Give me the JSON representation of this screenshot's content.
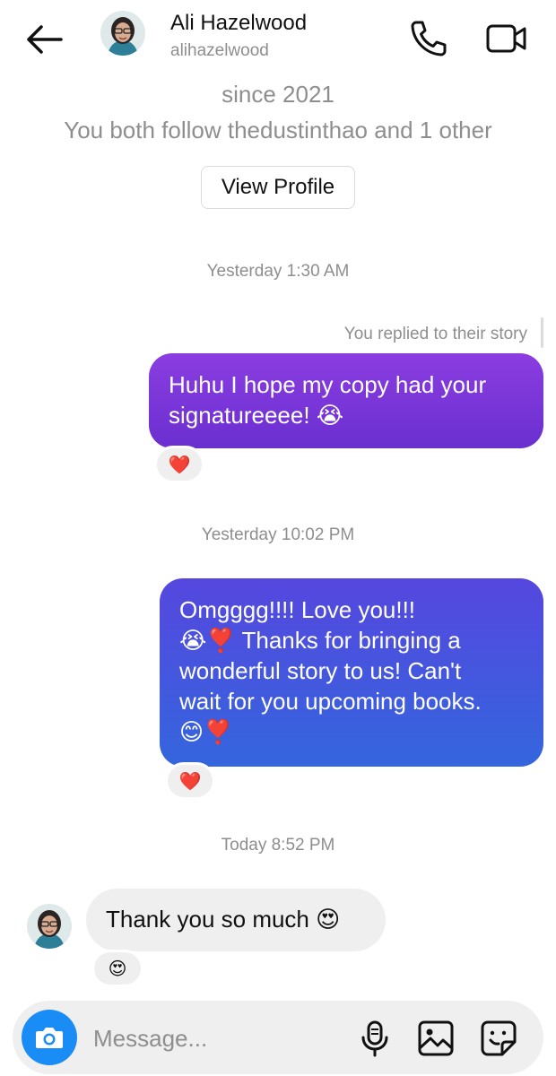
{
  "header": {
    "contact_name": "Ali Hazelwood",
    "username": "alihazelwood",
    "icons": [
      "back-arrow-icon",
      "phone-icon",
      "video-camera-icon"
    ]
  },
  "profile_info": {
    "since": "since 2021",
    "mutual": "You both follow thedustinthao and 1 other",
    "view_profile_label": "View Profile"
  },
  "messages": [
    {
      "timestamp": "Yesterday 1:30 AM",
      "context": "You replied to their story",
      "sender": "me",
      "lines": [
        "Huhu I hope my copy had your",
        "signatureeee! 😭"
      ],
      "reaction": "❤️"
    },
    {
      "timestamp": "Yesterday 10:02 PM",
      "sender": "me",
      "lines": [
        "Omgggg!!!! Love you!!!",
        "😭❣️ Thanks for bringing a",
        "wonderful story to us! Can't",
        "wait for you upcoming books.",
        "😊❣️"
      ],
      "reaction": "❤️"
    },
    {
      "timestamp": "Today 8:52 PM",
      "sender": "them",
      "lines": [
        "Thank you so much 😍"
      ],
      "reaction": "😍"
    }
  ],
  "composer": {
    "placeholder": "Message...",
    "icons": [
      "camera-icon",
      "microphone-icon",
      "image-icon",
      "sticker-icon"
    ]
  },
  "colors": {
    "bubble1_top": "#8b3de0",
    "bubble1_bottom": "#6a2fd0",
    "bubble2_top": "#5547de",
    "bubble2_bottom": "#3466de",
    "camera_button": "#1a8cf5",
    "received_bubble": "#efefef",
    "secondary_text": "#8e8e8e"
  }
}
